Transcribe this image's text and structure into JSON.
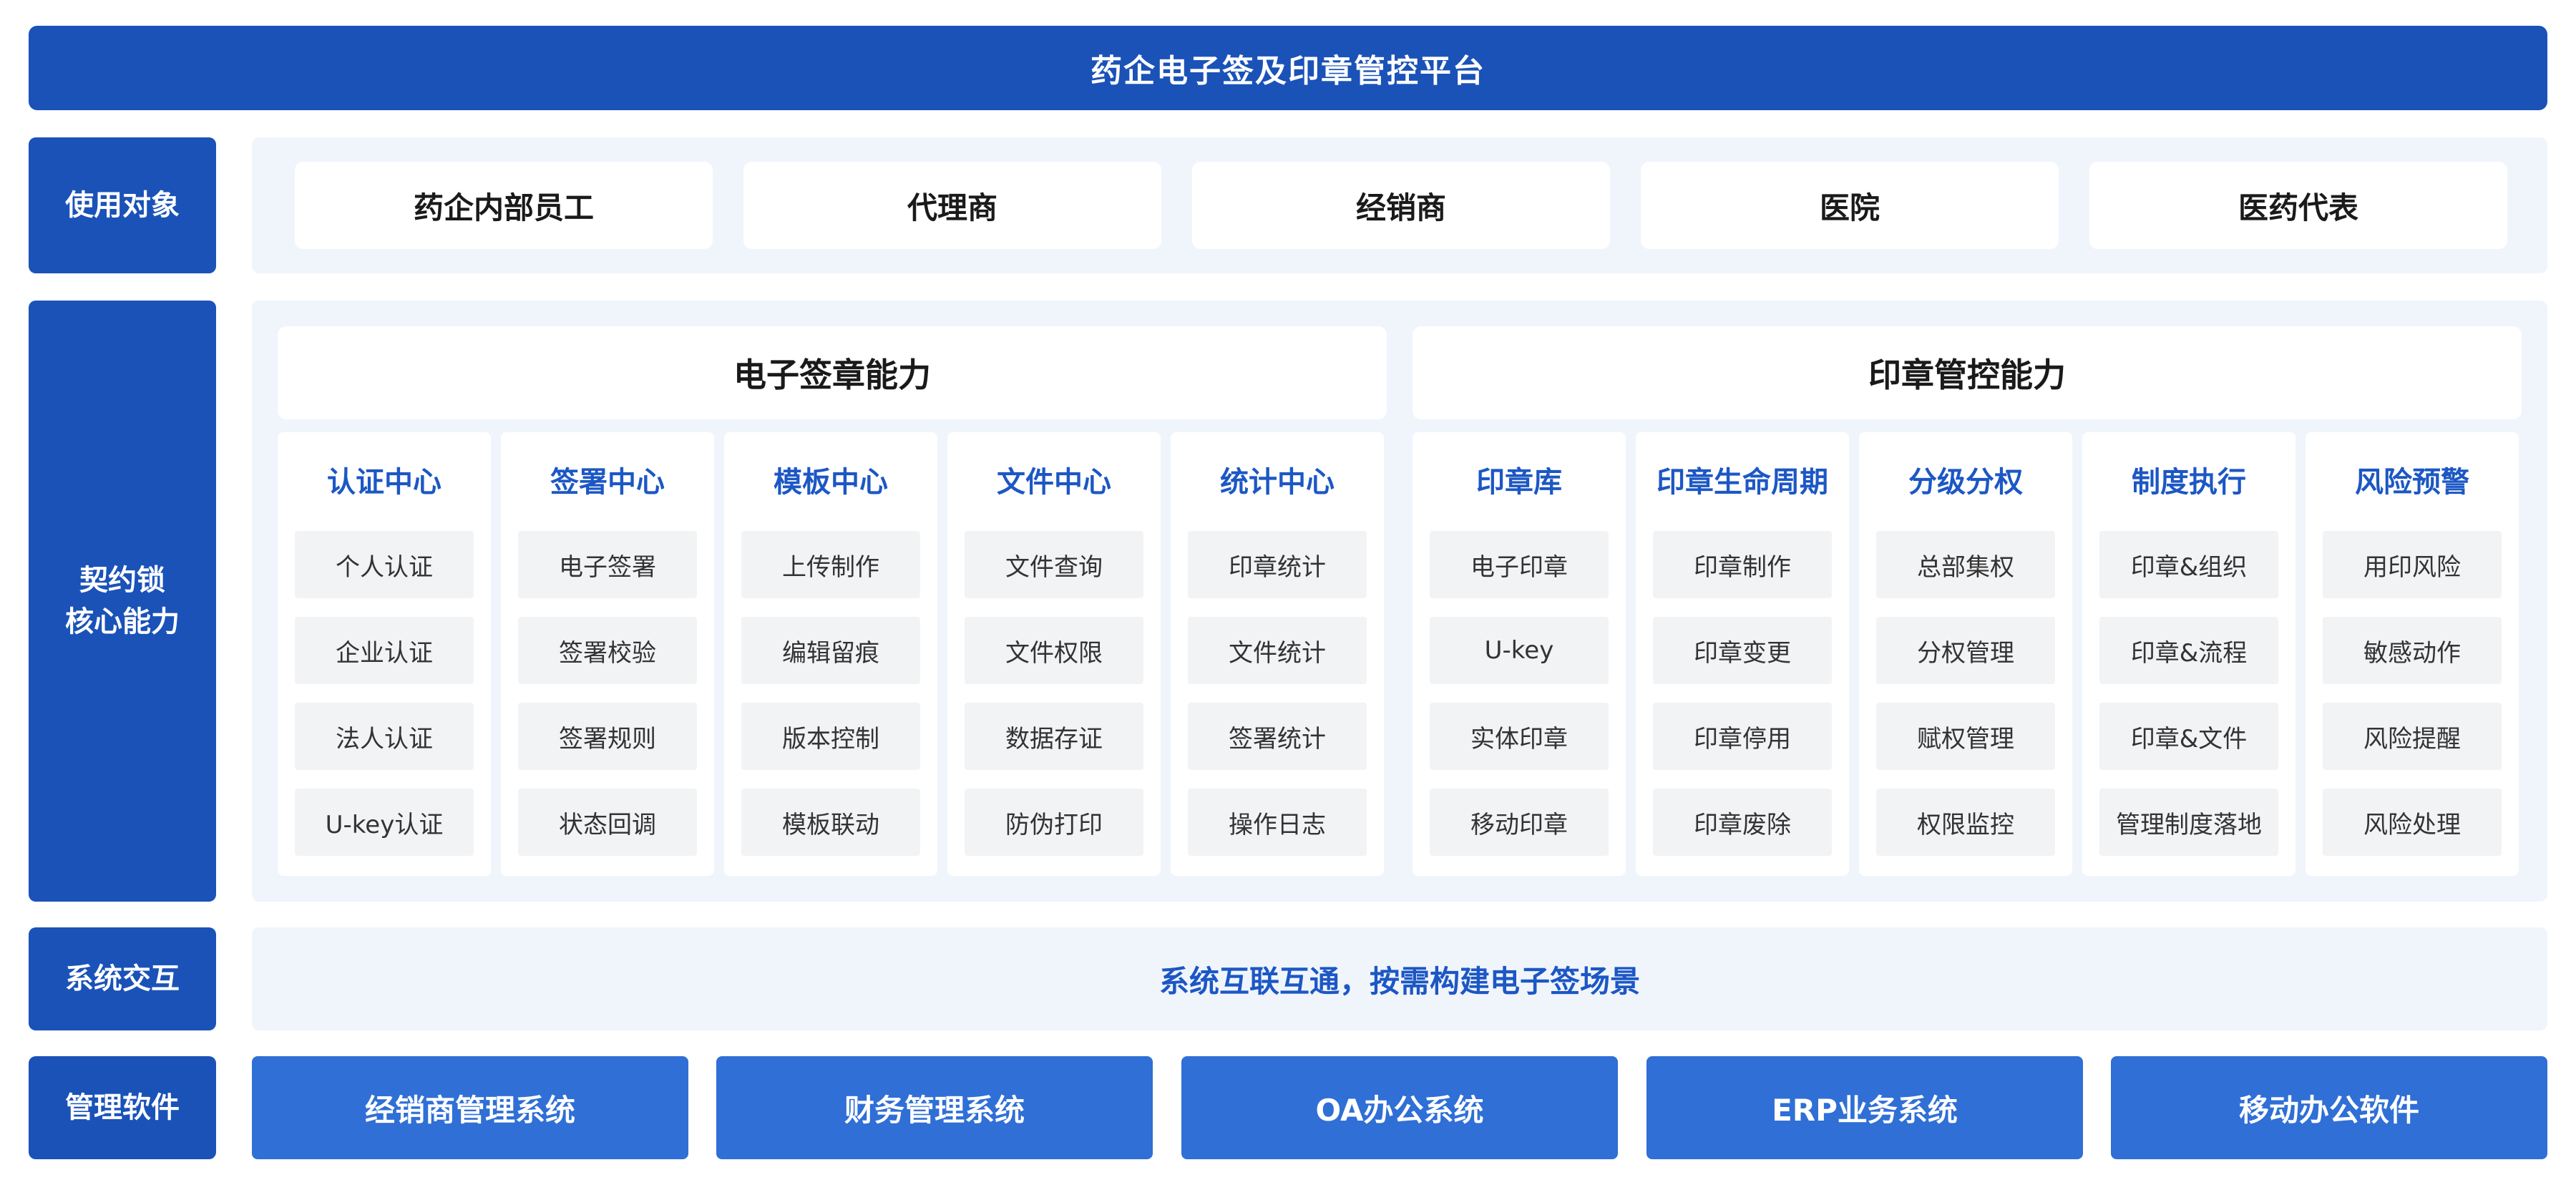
{
  "title": "药企电子签及印章管控平台",
  "rows": {
    "users": "使用对象",
    "core": "契约锁\n核心能力",
    "interaction": "系统交互",
    "software": "管理软件"
  },
  "users": [
    "药企内部员工",
    "代理商",
    "经销商",
    "医院",
    "医药代表"
  ],
  "sections": {
    "esign": "电子签章能力",
    "seal": "印章管控能力"
  },
  "columns": [
    {
      "title": "认证中心",
      "items": [
        "个人认证",
        "企业认证",
        "法人认证",
        "U-key认证"
      ]
    },
    {
      "title": "签署中心",
      "items": [
        "电子签署",
        "签署校验",
        "签署规则",
        "状态回调"
      ]
    },
    {
      "title": "模板中心",
      "items": [
        "上传制作",
        "编辑留痕",
        "版本控制",
        "模板联动"
      ]
    },
    {
      "title": "文件中心",
      "items": [
        "文件查询",
        "文件权限",
        "数据存证",
        "防伪打印"
      ]
    },
    {
      "title": "统计中心",
      "items": [
        "印章统计",
        "文件统计",
        "签署统计",
        "操作日志"
      ]
    },
    {
      "title": "印章库",
      "items": [
        "电子印章",
        "U-key",
        "实体印章",
        "移动印章"
      ]
    },
    {
      "title": "印章生命周期",
      "items": [
        "印章制作",
        "印章变更",
        "印章停用",
        "印章废除"
      ]
    },
    {
      "title": "分级分权",
      "items": [
        "总部集权",
        "分权管理",
        "赋权管理",
        "权限监控"
      ]
    },
    {
      "title": "制度执行",
      "items": [
        "印章&组织",
        "印章&流程",
        "印章&文件",
        "管理制度落地"
      ]
    },
    {
      "title": "风险预警",
      "items": [
        "用印风险",
        "敏感动作",
        "风险提醒",
        "风险处理"
      ]
    }
  ],
  "interaction_text": "系统互联互通，按需构建电子签场景",
  "systems": [
    "经销商管理系统",
    "财务管理系统",
    "OA办公系统",
    "ERP业务系统",
    "移动办公软件"
  ]
}
